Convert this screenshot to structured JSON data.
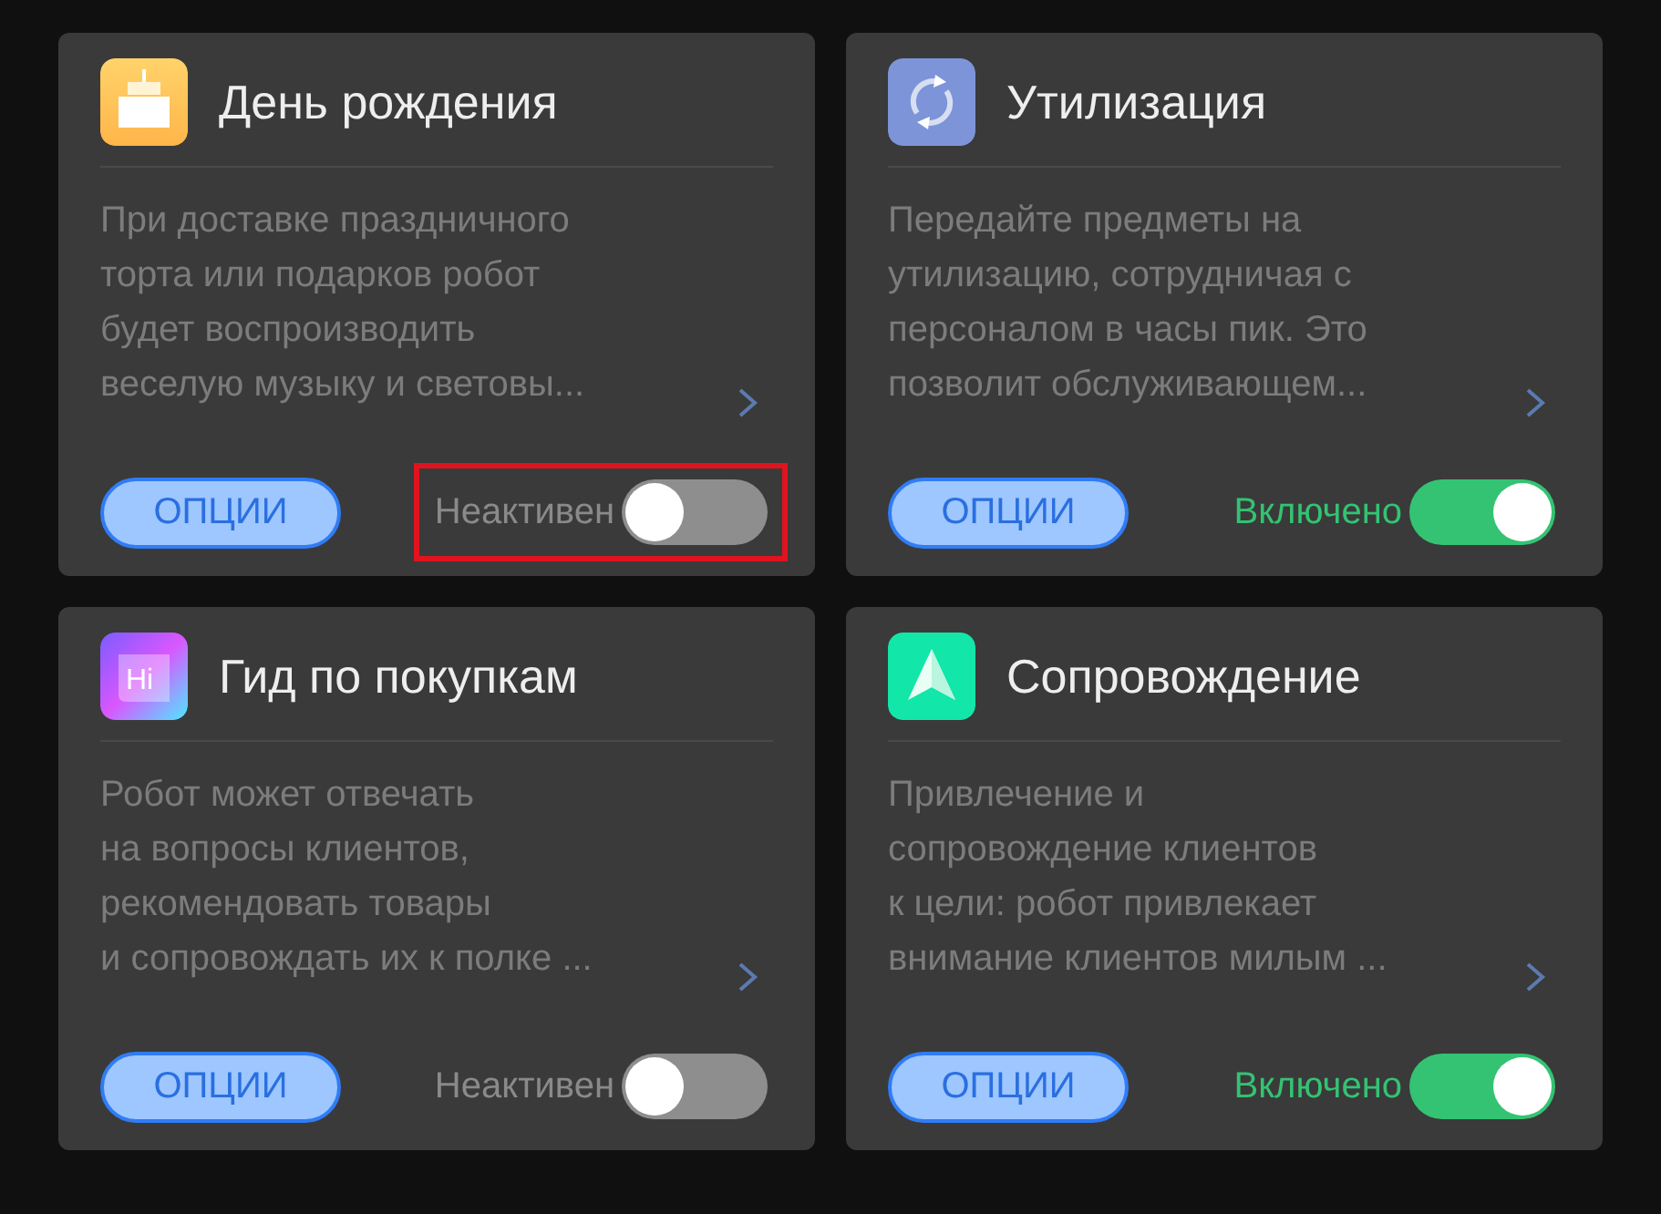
{
  "cards": [
    {
      "title": "День рождения",
      "description": "При доставке праздничного\nторта или подарков робот\nбудет воспроизводить\nвеселую музыку и световы...",
      "options_label": "ОПЦИИ",
      "status": "Неактивен",
      "on": false,
      "highlighted": true
    },
    {
      "title": "Утилизация",
      "description": "Передайте предметы на\nутилизацию, сотрудничая с\nперсоналом в часы пик. Это\nпозволит обслуживающем...",
      "options_label": "ОПЦИИ",
      "status": "Включено",
      "on": true,
      "highlighted": false
    },
    {
      "icon_text": "Hi",
      "title": "Гид по покупкам",
      "description": "Робот может отвечать\nна вопросы клиентов,\nрекомендовать товары\nи сопровождать их к полке ...",
      "options_label": "ОПЦИИ",
      "status": "Неактивен",
      "on": false,
      "highlighted": false
    },
    {
      "title": "Сопровождение",
      "description": "Привлечение и\nсопровождение клиентов\nк цели: робот привлекает\nвнимание клиентов милым ...",
      "options_label": "ОПЦИИ",
      "status": "Включено",
      "on": true,
      "highlighted": false
    }
  ]
}
